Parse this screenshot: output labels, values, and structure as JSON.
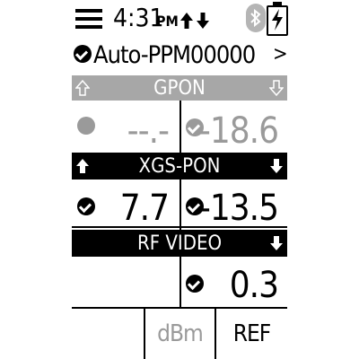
{
  "status_bar": {
    "time": "4:31",
    "ampm": "PM",
    "icons": [
      "menu-icon",
      "network-updown-icon",
      "bluetooth-icon",
      "battery-charging-icon"
    ]
  },
  "profile": {
    "name": "Auto-PPM00000",
    "chevron": ">"
  },
  "sections": {
    "gpon": {
      "title": "GPON",
      "tx_value": "--.-",
      "rx_value": "-18.6"
    },
    "xgspon": {
      "title": "XGS-PON",
      "tx_value": "7.7",
      "rx_value": "-13.5"
    },
    "rfvideo": {
      "title": "RF VIDEO",
      "rx_value": "0.3"
    }
  },
  "footer": {
    "unit_label": "dBm",
    "ref_label": "REF"
  },
  "colors": {
    "dark": "#000000",
    "dimmed": "#a7a7a7",
    "background": "#ffffff"
  }
}
